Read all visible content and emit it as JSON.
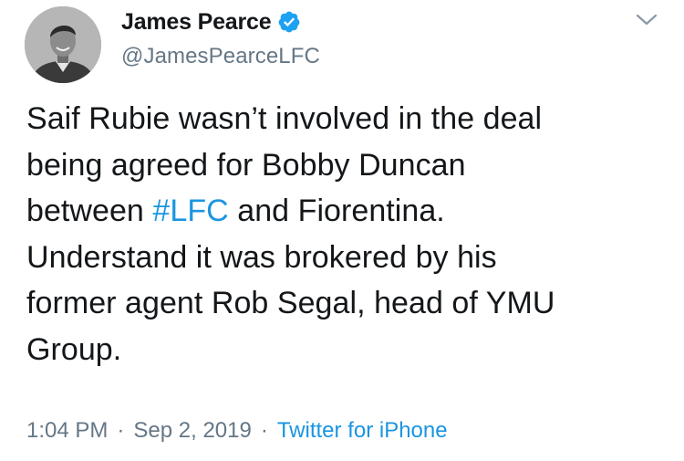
{
  "author": {
    "display_name": "James Pearce",
    "handle": "@JamesPearceLFC",
    "verified": true,
    "verified_icon": "verified-badge-icon"
  },
  "menu": {
    "icon": "chevron-down-icon"
  },
  "tweet": {
    "lines": [
      {
        "text": "Saif Rubie wasn’t involved in the deal"
      },
      {
        "text": "being agreed for Bobby Duncan"
      },
      {
        "before": "between ",
        "hashtag": "#LFC",
        "after": " and Fiorentina."
      },
      {
        "text": "Understand it was brokered by his"
      },
      {
        "text": "former agent Rob Segal, head of YMU"
      },
      {
        "text": "Group."
      }
    ]
  },
  "meta": {
    "time": "1:04 PM",
    "separator": "·",
    "date": "Sep 2, 2019",
    "source": "Twitter for iPhone"
  },
  "colors": {
    "text": "#14171a",
    "secondary": "#657786",
    "link": "#1b95e0",
    "verified": "#1da1f2"
  }
}
